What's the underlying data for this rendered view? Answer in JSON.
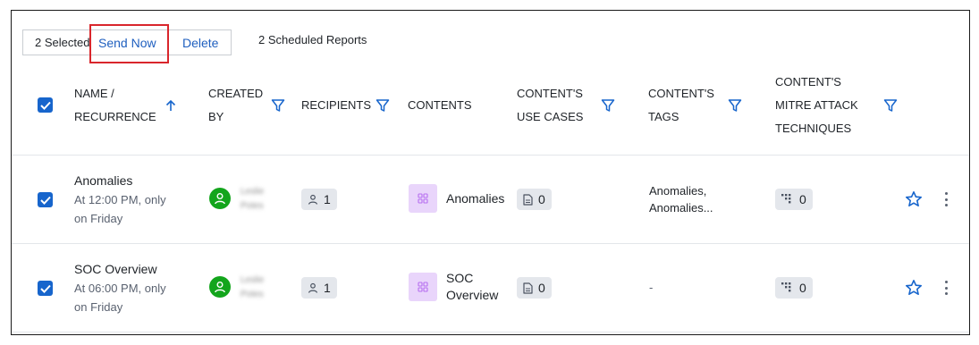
{
  "toolbar": {
    "selected_label": "2 Selected",
    "send_now_label": "Send Now",
    "delete_label": "Delete",
    "scheduled_count_label": "2 Scheduled Reports"
  },
  "header": {
    "name_line1": "NAME /",
    "name_line2": "RECURRENCE",
    "created_line1": "CREATED",
    "created_line2": "BY",
    "recipients": "RECIPIENTS",
    "contents": "CONTENTS",
    "use_cases_line1": "CONTENT'S",
    "use_cases_line2": "USE CASES",
    "tags_line1": "CONTENT'S",
    "tags_line2": "TAGS",
    "mitre_line1": "CONTENT'S",
    "mitre_line2": "MITRE ATTACK",
    "mitre_line3": "TECHNIQUES"
  },
  "rows": [
    {
      "name": "Anomalies",
      "recurrence_line1": "At 12:00 PM, only",
      "recurrence_line2": "on Friday",
      "creator_line1": "Leslie",
      "creator_line2": "Potes",
      "recipients_count": "1",
      "content_line1": "Anomalies",
      "content_line2": "",
      "use_cases_count": "0",
      "tags_line1": "Anomalies,",
      "tags_line2": "Anomalies...",
      "mitre_count": "0"
    },
    {
      "name": "SOC Overview",
      "recurrence_line1": "At 06:00 PM, only",
      "recurrence_line2": "on Friday",
      "creator_line1": "Leslie",
      "creator_line2": "Potes",
      "recipients_count": "1",
      "content_line1": "SOC",
      "content_line2": "Overview",
      "use_cases_count": "0",
      "tags_line1": "-",
      "tags_line2": "",
      "mitre_count": "0"
    }
  ],
  "colors": {
    "accent_blue": "#1765cc",
    "link_blue": "#1f5fbf",
    "avatar_green": "#13a51c",
    "content_tile_purple": "#e9d5fb",
    "highlight_red": "#d9262c"
  },
  "icons": {
    "sort": "arrow-up-icon",
    "filter": "filter-icon",
    "user": "user-icon",
    "document": "document-icon",
    "grid": "grid-icon",
    "mitre": "mitre-dots-icon",
    "star": "star-icon",
    "more": "kebab-icon"
  }
}
